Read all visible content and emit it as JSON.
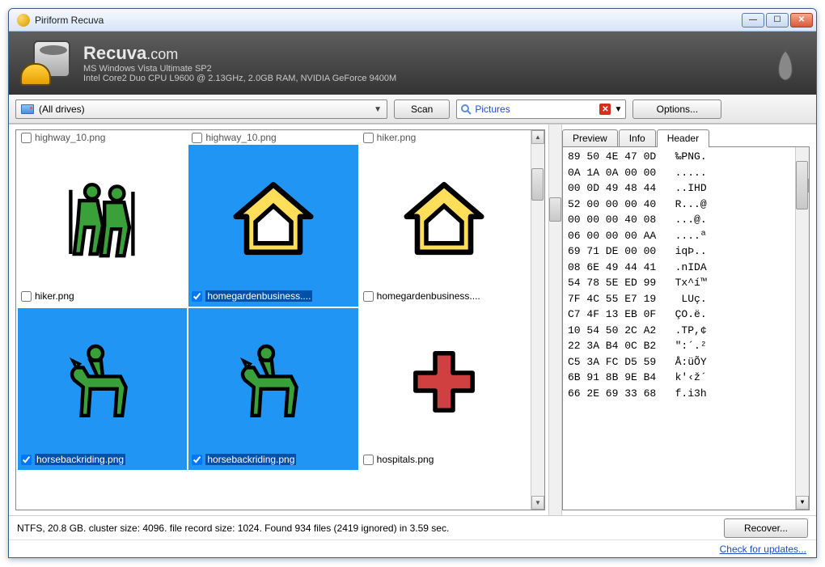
{
  "window": {
    "title": "Piriform Recuva"
  },
  "banner": {
    "brand": "Recuva",
    "brand_suffix": ".com",
    "sys1": "MS Windows Vista Ultimate SP2",
    "sys2": "Intel Core2 Duo CPU L9600 @ 2.13GHz, 2.0GB RAM, NVIDIA GeForce 9400M"
  },
  "toolbar": {
    "drive_label": "(All drives)",
    "scan_label": "Scan",
    "filter_text": "Pictures",
    "options_label": "Options..."
  },
  "files": {
    "top_truncated": [
      "highway_10.png",
      "highway_10.png",
      "hiker.png"
    ],
    "row1": [
      {
        "name": "hiker.png",
        "checked": false,
        "selected": false,
        "icon": "hiker"
      },
      {
        "name": "homegardenbusiness....",
        "checked": true,
        "selected": true,
        "icon": "house-yellow"
      },
      {
        "name": "homegardenbusiness....",
        "checked": false,
        "selected": false,
        "icon": "house-yellow"
      }
    ],
    "row2": [
      {
        "name": "horsebackriding.png",
        "checked": true,
        "selected": true,
        "icon": "horse"
      },
      {
        "name": "horsebackriding.png",
        "checked": true,
        "selected": true,
        "icon": "horse"
      },
      {
        "name": "hospitals.png",
        "checked": false,
        "selected": false,
        "icon": "cross"
      }
    ]
  },
  "tabs": {
    "preview": "Preview",
    "info": "Info",
    "header": "Header",
    "active": "header"
  },
  "hex": [
    "89 50 4E 47 0D   ‰PNG.",
    "0A 1A 0A 00 00   .....",
    "00 0D 49 48 44   ..IHD",
    "52 00 00 00 40   R...@",
    "00 00 00 40 08   ...@.",
    "06 00 00 00 AA   ....ª",
    "69 71 DE 00 00   iqÞ..",
    "08 6E 49 44 41   .nIDA",
    "54 78 5E ED 99   Tx^í™",
    "7F 4C 55 E7 19    LUç.",
    "C7 4F 13 EB 0F   ÇO.ë.",
    "10 54 50 2C A2   .TP,¢",
    "22 3A B4 0C B2   \":´.²",
    "C5 3A FC D5 59   Å:üÕY",
    "6B 91 8B 9E B4   k'‹ž´",
    "66 2E 69 33 68   f.i3h"
  ],
  "status": "NTFS, 20.8 GB. cluster size: 4096. file record size: 1024. Found 934 files (2419 ignored) in 3.59 sec.",
  "recover_label": "Recover...",
  "footer_link": "Check for updates..."
}
